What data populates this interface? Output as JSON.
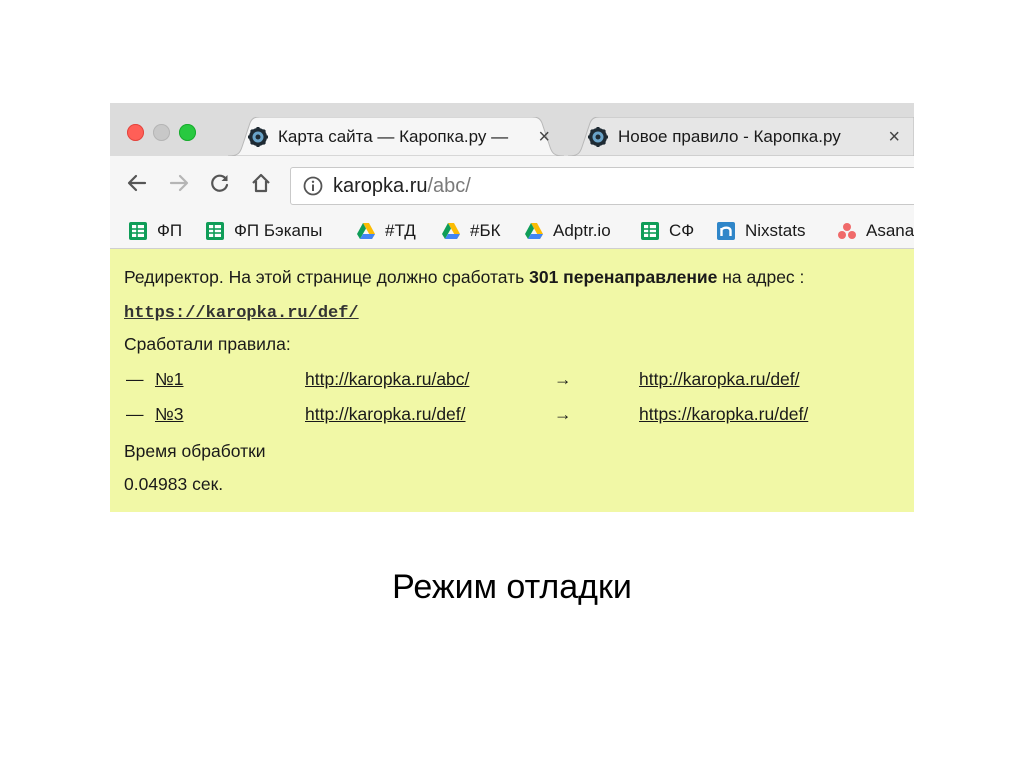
{
  "tabs": [
    {
      "title": "Карта сайта — Каропка.ру — ",
      "favicon": "gear-icon",
      "close": "×",
      "active": true
    },
    {
      "title": "Новое правило - Каропка.ру",
      "favicon": "gear-icon",
      "close": "×",
      "active": false
    }
  ],
  "address": {
    "host": "karopka.ru",
    "path": "/abc/",
    "icon": "info-icon"
  },
  "bookmarks": [
    {
      "label": "ФП",
      "icon": "google-sheets-icon"
    },
    {
      "label": "ФП Бэкапы",
      "icon": "google-sheets-icon"
    },
    {
      "label": "#ТД",
      "icon": "google-drive-icon"
    },
    {
      "label": "#БК",
      "icon": "google-drive-icon"
    },
    {
      "label": "Adptr.io",
      "icon": "google-drive-icon"
    },
    {
      "label": "СФ",
      "icon": "google-sheets-icon"
    },
    {
      "label": "Nixstats",
      "icon": "nixstats-icon"
    },
    {
      "label": "Asana",
      "icon": "asana-icon"
    }
  ],
  "page": {
    "redirector_label": "Редиректор.",
    "redirect_text_1": " На этой странице должно сработать ",
    "redirect_bold": "301 перенаправление",
    "redirect_text_2": " на адрес :",
    "target_url": "https://karopka.ru/def/",
    "rules_heading": "Сработали правила:",
    "rules": [
      {
        "dash": "—",
        "rule": "№1",
        "from": "http://karopka.ru/abc/",
        "arrow": "→",
        "to": "http://karopka.ru/def/"
      },
      {
        "dash": "—",
        "rule": "№3",
        "from": "http://karopka.ru/def/",
        "arrow": "→",
        "to": "https://karopka.ru/def/"
      }
    ],
    "time_label": "Время обработки",
    "time_value": "0.04983 сек."
  },
  "caption": "Режим отладки",
  "colors": {
    "page_background": "#f1f8a6",
    "tab_bar": "#dcdcdc",
    "toolbar": "#f6f6f6"
  }
}
